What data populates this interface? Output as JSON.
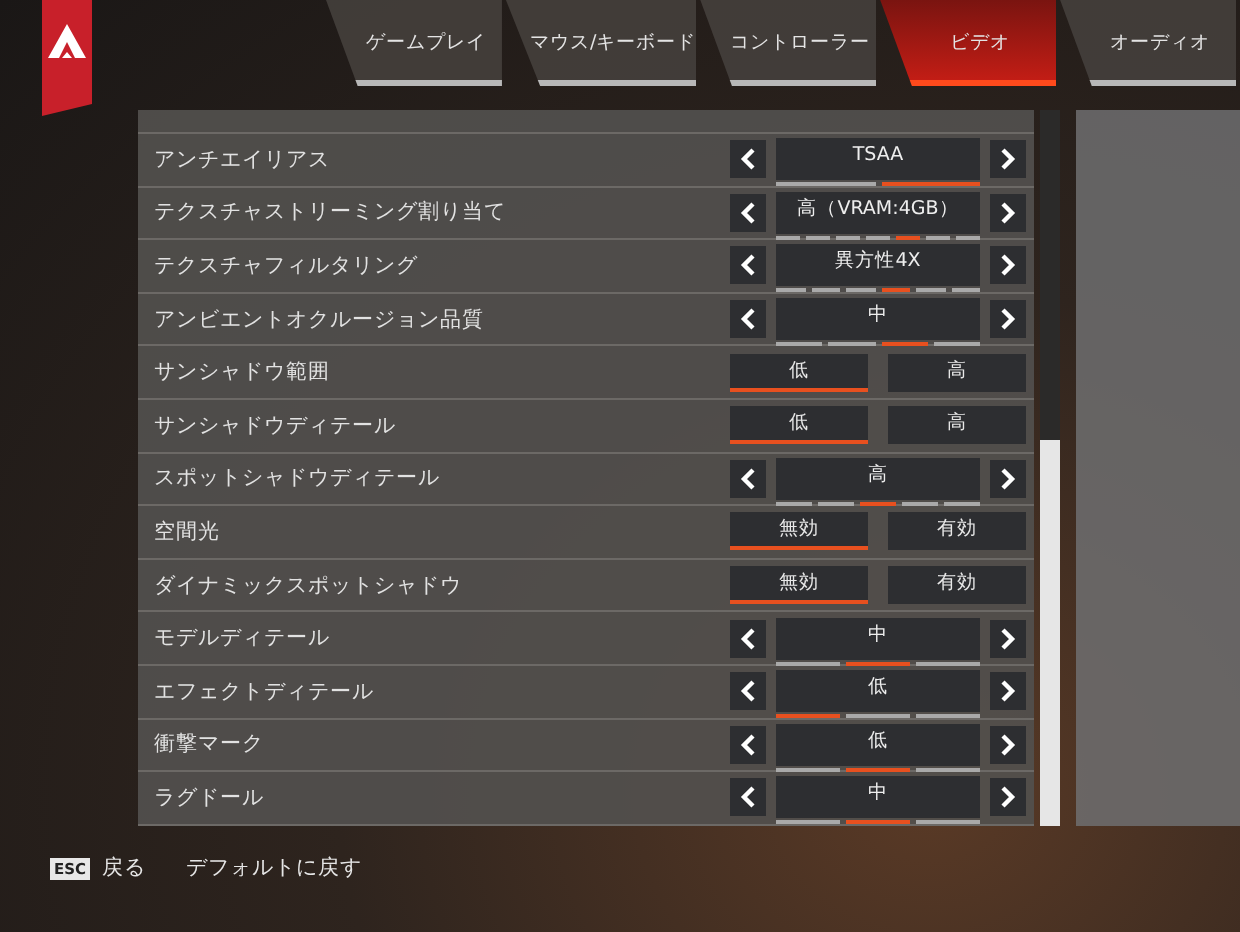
{
  "tabs": [
    {
      "label": "ゲームプレイ",
      "selected": false
    },
    {
      "label": "マウス/キーボード",
      "selected": false
    },
    {
      "label": "コントローラー",
      "selected": false
    },
    {
      "label": "ビデオ",
      "selected": true
    },
    {
      "label": "オーディオ",
      "selected": false
    }
  ],
  "settings": [
    {
      "kind": "selector",
      "label": "アンチエイリアス",
      "value": "TSAA",
      "steps": [
        {
          "selected": false
        },
        {
          "selected": true
        }
      ]
    },
    {
      "kind": "selector",
      "label": "テクスチャストリーミング割り当て",
      "value": "高（VRAM:4GB）",
      "steps": [
        {
          "selected": false
        },
        {
          "selected": false
        },
        {
          "selected": false
        },
        {
          "selected": false
        },
        {
          "selected": true
        },
        {
          "selected": false
        },
        {
          "selected": false
        }
      ]
    },
    {
      "kind": "selector",
      "label": "テクスチャフィルタリング",
      "value": "異方性4X",
      "steps": [
        {
          "selected": false
        },
        {
          "selected": false
        },
        {
          "selected": false
        },
        {
          "selected": true
        },
        {
          "selected": false
        },
        {
          "selected": false
        }
      ]
    },
    {
      "kind": "selector",
      "label": "アンビエントオクルージョン品質",
      "value": "中",
      "steps": [
        {
          "selected": false
        },
        {
          "selected": false
        },
        {
          "selected": true
        },
        {
          "selected": false
        }
      ]
    },
    {
      "kind": "toggle",
      "label": "サンシャドウ範囲",
      "options": [
        {
          "label": "低",
          "selected": true
        },
        {
          "label": "高",
          "selected": false
        }
      ]
    },
    {
      "kind": "toggle",
      "label": "サンシャドウディテール",
      "options": [
        {
          "label": "低",
          "selected": true
        },
        {
          "label": "高",
          "selected": false
        }
      ]
    },
    {
      "kind": "selector",
      "label": "スポットシャドウディテール",
      "value": "高",
      "steps": [
        {
          "selected": false
        },
        {
          "selected": false
        },
        {
          "selected": true
        },
        {
          "selected": false
        },
        {
          "selected": false
        }
      ]
    },
    {
      "kind": "toggle",
      "label": "空間光",
      "options": [
        {
          "label": "無効",
          "selected": true
        },
        {
          "label": "有効",
          "selected": false
        }
      ]
    },
    {
      "kind": "toggle",
      "label": "ダイナミックスポットシャドウ",
      "options": [
        {
          "label": "無効",
          "selected": true
        },
        {
          "label": "有効",
          "selected": false
        }
      ]
    },
    {
      "kind": "selector",
      "label": "モデルディテール",
      "value": "中",
      "steps": [
        {
          "selected": false
        },
        {
          "selected": true
        },
        {
          "selected": false
        }
      ]
    },
    {
      "kind": "selector",
      "label": "エフェクトディテール",
      "value": "低",
      "steps": [
        {
          "selected": true
        },
        {
          "selected": false
        },
        {
          "selected": false
        }
      ]
    },
    {
      "kind": "selector",
      "label": "衝撃マーク",
      "value": "低",
      "steps": [
        {
          "selected": false
        },
        {
          "selected": true
        },
        {
          "selected": false
        }
      ]
    },
    {
      "kind": "selector",
      "label": "ラグドール",
      "value": "中",
      "steps": [
        {
          "selected": false
        },
        {
          "selected": true
        },
        {
          "selected": false
        }
      ]
    }
  ],
  "footer": {
    "key": "ESC",
    "back": "戻る",
    "reset": "デフォルトに戻す"
  }
}
